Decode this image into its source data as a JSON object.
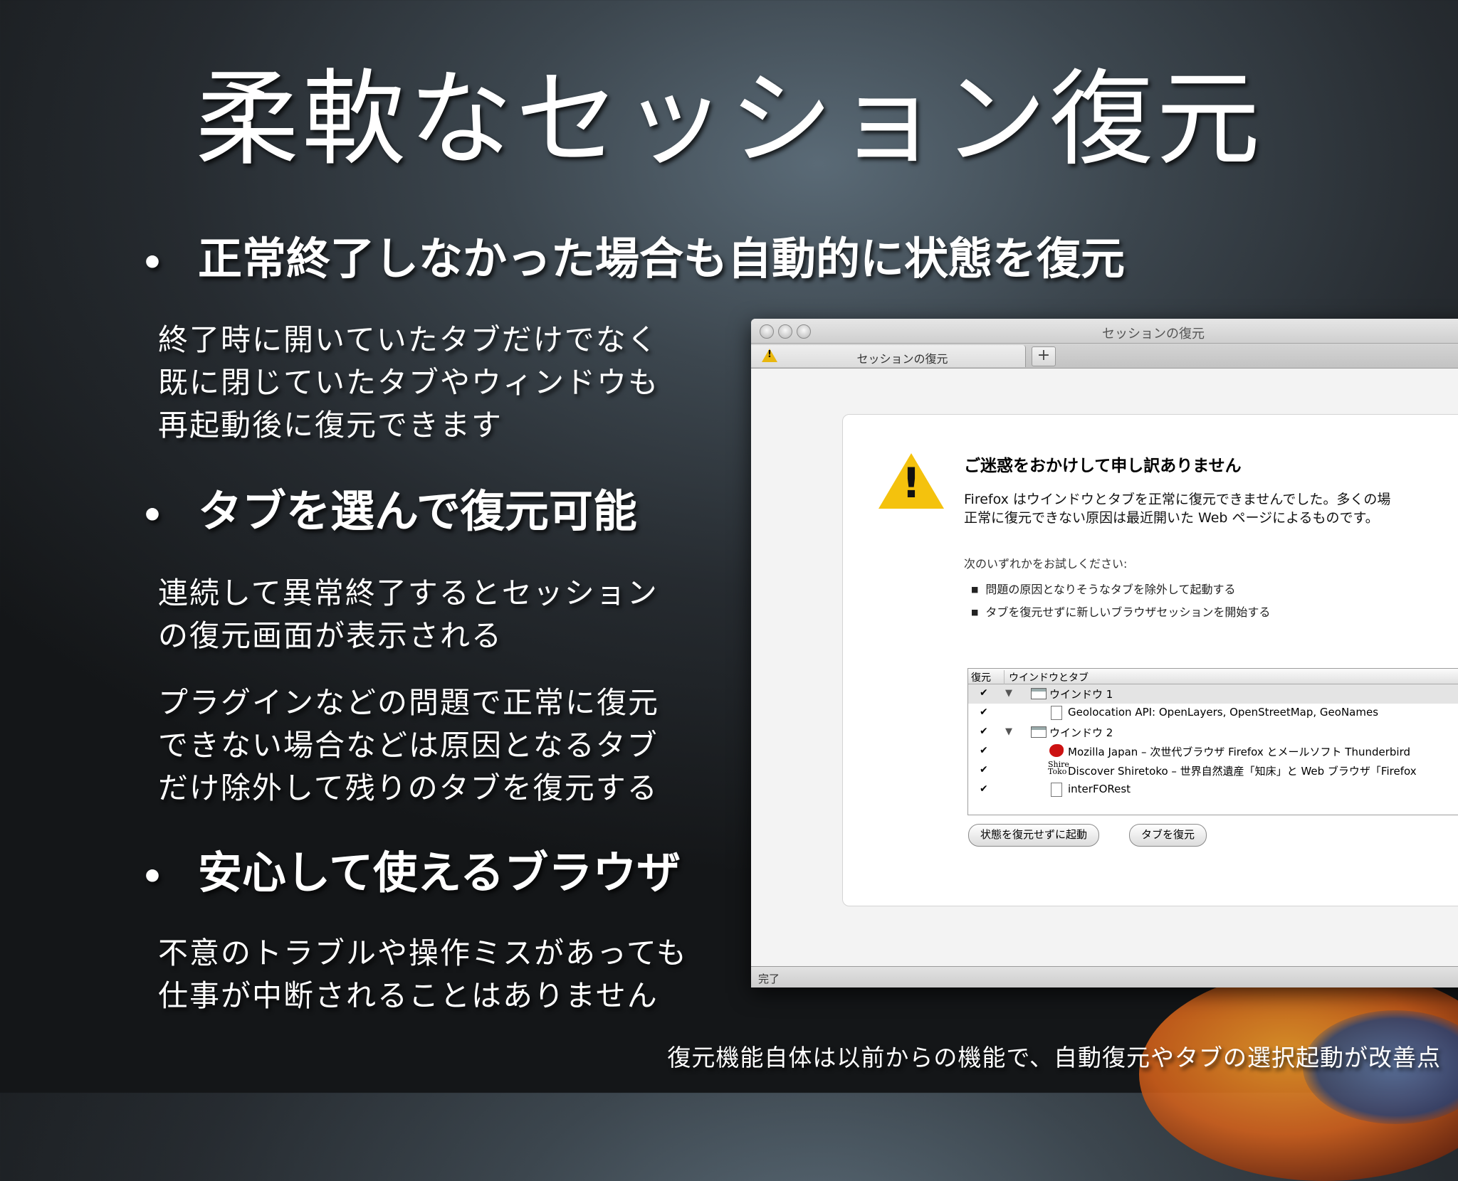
{
  "slide": {
    "title": "柔軟なセッション復元",
    "bullets": [
      {
        "text": "正常終了しなかった場合も自動的に状態を復元"
      },
      {
        "text": "タブを選んで復元可能"
      },
      {
        "text": "安心して使えるブラウザ"
      }
    ],
    "paragraphs": [
      [
        "終了時に開いていたタブだけでなく",
        "既に閉じていたタブやウィンドウも",
        "再起動後に復元できます"
      ],
      [
        "連続して異常終了するとセッション",
        "の復元画面が表示される"
      ],
      [
        "プラグインなどの問題で正常に復元",
        "できない場合などは原因となるタブ",
        "だけ除外して残りのタブを復元する"
      ],
      [
        "不意のトラブルや操作ミスがあっても",
        "仕事が中断されることはありません"
      ]
    ],
    "footnote": "復元機能自体は以前からの機能で、自動復元やタブの選択起動が改善点"
  },
  "window": {
    "title": "セッションの復元",
    "tab_label": "セッションの復元",
    "new_tab": "+",
    "error_title": "ご迷惑をおかけして申し訳ありません",
    "error_text": [
      "Firefox はウインドウとタブを正常に復元できませんでした。多くの場",
      "正常に復元できない原因は最近開いた Web ページによるものです。"
    ],
    "try_text": "次のいずれかをお試しください:",
    "options": [
      "問題の原因となりそうなタブを除外して起動する",
      "タブを復元せずに新しいブラウザセッションを開始する"
    ],
    "tree_headers": {
      "restore": "復元",
      "windows_tabs": "ウインドウとタブ"
    },
    "tree_rows": [
      {
        "check": "✔",
        "type": "window",
        "label": "ウインドウ 1"
      },
      {
        "check": "✔",
        "type": "tab",
        "label": "Geolocation API: OpenLayers, OpenStreetMap, GeoNames"
      },
      {
        "check": "✔",
        "type": "window",
        "label": "ウインドウ 2"
      },
      {
        "check": "✔",
        "type": "tab",
        "label": "Mozilla Japan – 次世代ブラウザ Firefox とメールソフト Thunderbird"
      },
      {
        "check": "✔",
        "type": "tab",
        "label": "Discover Shiretoko – 世界自然遺産「知床」と Web ブラウザ「Firefox"
      },
      {
        "check": "✔",
        "type": "tab",
        "label": "interFORest"
      }
    ],
    "tree_icon_text": {
      "shire": "Shire",
      "toko": "Toko"
    },
    "buttons": {
      "no_restore": "状態を復元せずに起動",
      "restore_tabs": "タブを復元"
    },
    "status": "完了",
    "colors": {
      "warning": "#f4c20d",
      "mozilla": "#cc1111"
    }
  }
}
